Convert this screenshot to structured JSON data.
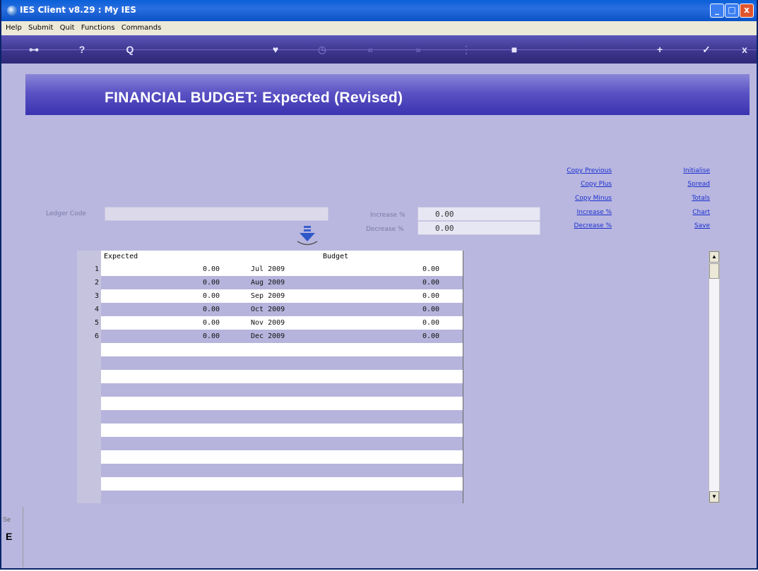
{
  "window": {
    "title": "IES Client v8.29 : My IES",
    "controls": {
      "minimize": "_",
      "maximize": "□",
      "close": "x"
    }
  },
  "menu": [
    "Help",
    "Submit",
    "Quit",
    "Functions",
    "Commands"
  ],
  "toolbar": {
    "icons": [
      "key-icon",
      "help-icon",
      "search-icon",
      "heart-icon",
      "clock-icon",
      "rewind-icon",
      "fast-forward-icon",
      "ellipsis-icon",
      "stop-icon",
      "plus-icon",
      "check-icon",
      "close-icon"
    ],
    "glyphs": {
      "key": "⊶",
      "help": "?",
      "search": "Q",
      "heart": "♥",
      "clock": "◷",
      "rewind": "«",
      "forward": "»",
      "ellipsis": "⋮",
      "stop": "■",
      "plus": "+",
      "check": "✓",
      "close": "x"
    }
  },
  "page": {
    "title": "FINANCIAL BUDGET: Expected (Revised)"
  },
  "form": {
    "ledger_label": "Ledger Code",
    "ledger_value": "",
    "increase_label": "Increase %",
    "increase_value": "0.00",
    "decrease_label": "Decrease %",
    "decrease_value": "0.00"
  },
  "actions_left": [
    "Copy Previous",
    "Copy Plus",
    "Copy Minus",
    "Increase %",
    "Decrease %"
  ],
  "actions_right": [
    "Initialise",
    "Spread",
    "Totals",
    "Chart",
    "Save"
  ],
  "grid": {
    "headers": {
      "expected": "Expected",
      "budget": "Budget"
    },
    "rows": [
      {
        "n": "1",
        "expected": "0.00",
        "period": "Jul 2009",
        "budget": "0.00"
      },
      {
        "n": "2",
        "expected": "0.00",
        "period": "Aug 2009",
        "budget": "0.00"
      },
      {
        "n": "3",
        "expected": "0.00",
        "period": "Sep 2009",
        "budget": "0.00"
      },
      {
        "n": "4",
        "expected": "0.00",
        "period": "Oct 2009",
        "budget": "0.00"
      },
      {
        "n": "5",
        "expected": "0.00",
        "period": "Nov 2009",
        "budget": "0.00"
      },
      {
        "n": "6",
        "expected": "0.00",
        "period": "Dec 2009",
        "budget": "0.00"
      }
    ]
  },
  "scrollbar": {
    "up": "▲",
    "down": "▼"
  },
  "side": {
    "text1": "Se",
    "text2": "E"
  }
}
